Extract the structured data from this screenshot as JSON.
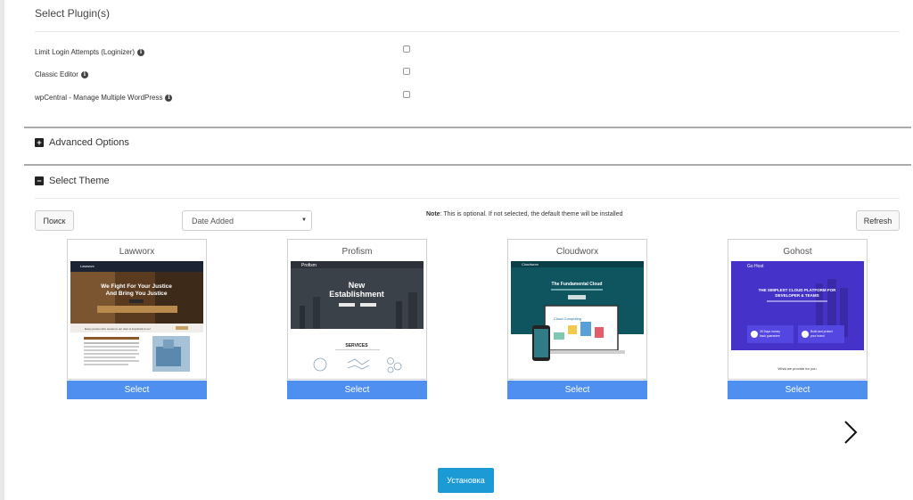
{
  "plugins_section": {
    "title": "Select Plugin(s)",
    "items": [
      {
        "label": "Limit Login Attempts (Loginizer)",
        "checked": false
      },
      {
        "label": "Classic Editor",
        "checked": false
      },
      {
        "label": "wpCentral - Manage Multiple WordPress",
        "checked": false
      }
    ],
    "info_icon": "info-icon"
  },
  "advanced_options": {
    "label": "Advanced Options",
    "toggle": "+"
  },
  "select_theme": {
    "label": "Select Theme",
    "toggle": "−",
    "search_button": "Поиск",
    "sort_select": {
      "value": "Date Added"
    },
    "note_bold": "Note",
    "note_text": ": This is optional. If not selected, the default theme will be installed",
    "refresh_button": "Refresh",
    "select_label": "Select",
    "themes": [
      {
        "name": "Lawworx",
        "preview": {
          "brand": "Lawworx",
          "hero_line1": "We Fight For Your Justice",
          "hero_line2": "And Bring You Justice",
          "tagline": "Every person who comes to our door is important to us!",
          "body_heading": "We will not be fooled and trust us, we are always ready to earn you the best services for better fixed"
        }
      },
      {
        "name": "Profism",
        "preview": {
          "brand": "Profism",
          "hero_line1": "New",
          "hero_line2": "Establishment",
          "services": "SERVICES"
        }
      },
      {
        "name": "Cloudworx",
        "preview": {
          "brand": "Cloudworx",
          "hero": "The Fundamental Cloud",
          "screen_text": "Cloud Computing"
        }
      },
      {
        "name": "Gohost",
        "preview": {
          "brand": "Go Host",
          "hero_line1": "THE SIMPLEST CLOUD PLATFORM FOR",
          "hero_line2": "DEVELOPER & TEAMS",
          "card1_line1": "30 Days money",
          "card1_line2": "back guarantee",
          "card2_line1": "Build and protect",
          "card2_line2": "your brand",
          "footer": "What we provide for you"
        }
      }
    ],
    "next_icon": "chevron-right-icon"
  },
  "install_button": "Установка",
  "colors": {
    "select_button": "#4f8ff0",
    "install_button": "#1b9ad6",
    "gohost_brand": "#4533c9",
    "cloudworx_bg": "#0f5560"
  }
}
